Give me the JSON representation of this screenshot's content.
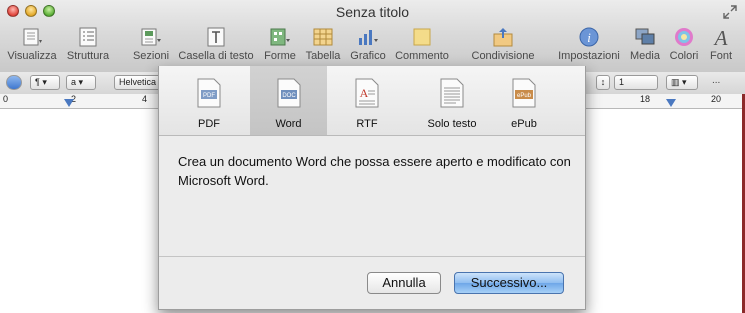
{
  "window": {
    "title": "Senza titolo"
  },
  "toolbar": {
    "items": [
      {
        "label": "Visualizza",
        "icon": "view-icon"
      },
      {
        "label": "Struttura",
        "icon": "outline-icon"
      },
      {
        "label": "Sezioni",
        "icon": "sections-icon"
      },
      {
        "label": "Casella di testo",
        "icon": "textbox-icon"
      },
      {
        "label": "Forme",
        "icon": "shapes-icon"
      },
      {
        "label": "Tabella",
        "icon": "table-icon"
      },
      {
        "label": "Grafico",
        "icon": "chart-icon"
      },
      {
        "label": "Commento",
        "icon": "comment-icon"
      },
      {
        "label": "Condivisione",
        "icon": "share-icon"
      },
      {
        "label": "Impostazioni",
        "icon": "info-icon"
      },
      {
        "label": "Media",
        "icon": "media-icon"
      },
      {
        "label": "Colori",
        "icon": "colors-icon"
      },
      {
        "label": "Font",
        "icon": "font-icon"
      }
    ]
  },
  "formatbar": {
    "paragraph": "¶",
    "style": "a",
    "font": "Helvetica",
    "line_spacing": "1",
    "more": "..."
  },
  "ruler": {
    "numbers": [
      "0",
      "2",
      "4",
      "18",
      "20"
    ]
  },
  "export_sheet": {
    "formats": [
      {
        "label": "PDF",
        "badge": "PDF",
        "selected": false
      },
      {
        "label": "Word",
        "badge": "DOC",
        "selected": true
      },
      {
        "label": "RTF",
        "badge": "A",
        "selected": false
      },
      {
        "label": "Solo testo",
        "badge": "",
        "selected": false
      },
      {
        "label": "ePub",
        "badge": "ePub",
        "selected": false
      }
    ],
    "description": "Crea un documento Word che possa essere aperto e modificato con Microsoft Word.",
    "cancel_label": "Annulla",
    "next_label": "Successivo..."
  },
  "colors": {
    "accent": "#6ea7e8",
    "selected_format_bg": "#c8c8c8"
  }
}
